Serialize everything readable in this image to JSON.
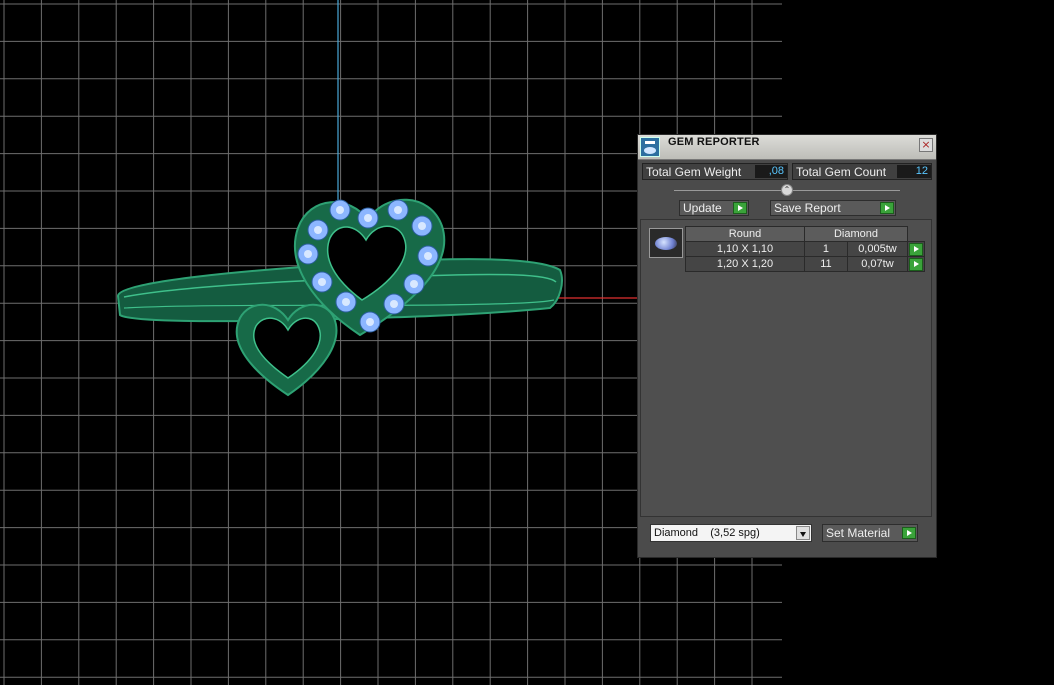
{
  "panel": {
    "title": "GEM REPORTER",
    "close_glyph": "×",
    "total_weight_label": "Total Gem Weight",
    "total_weight_value": ",08",
    "total_count_label": "Total Gem Count",
    "total_count_value": "12",
    "update_label": "Update",
    "save_report_label": "Save Report",
    "table": {
      "headers": [
        "Round",
        "Diamond"
      ],
      "rows": [
        {
          "size": "1,10 X 1,10",
          "count": "1",
          "weight": "0,005tw"
        },
        {
          "size": "1,20 X 1,20",
          "count": "11",
          "weight": "0,07tw"
        }
      ]
    },
    "material_value": "Diamond    (3,52 spg)",
    "set_material_label": "Set Material",
    "separator_glyph": "⌃"
  },
  "colors": {
    "background": "#000000",
    "grid": "#7a7a7a",
    "axis_vertical": "#4aa8d8",
    "axis_horizontal": "#e03030",
    "ring_metal": "#1e7a55",
    "gem": "#8cb6ff",
    "button_arrow": "#3aa33a",
    "value_text": "#59c7ff"
  },
  "icons": {
    "app": "gem-reporter-icon",
    "close": "close-icon",
    "gem_thumbnail": "round-gem-icon",
    "dropdown": "chevron-down-icon",
    "action": "play-arrow-icon"
  }
}
